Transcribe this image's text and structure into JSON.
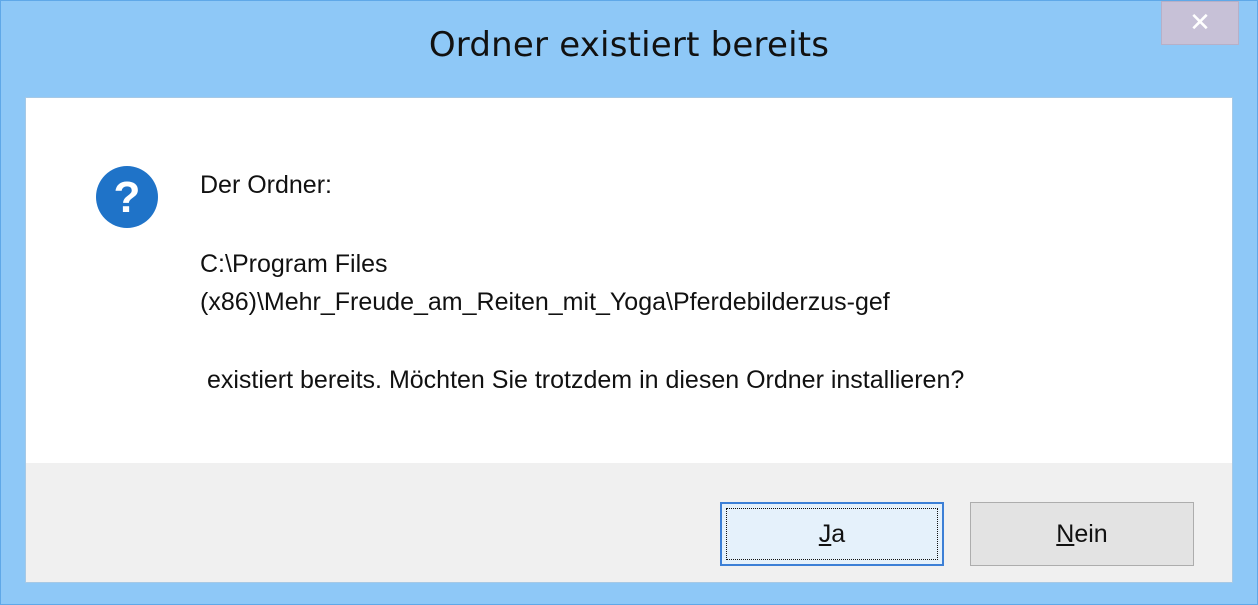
{
  "dialog": {
    "title": "Ordner existiert bereits",
    "close_glyph": "✕",
    "icon": "question-icon",
    "icon_color": "#1f73c8",
    "message": {
      "line1": "Der Ordner:",
      "path_line1": "C:\\Program Files",
      "path_line2": "(x86)\\Mehr_Freude_am_Reiten_mit_Yoga\\Pferdebilderzus-gef",
      "line3": " existiert bereits. Möchten Sie trotzdem in diesen Ordner installieren?"
    },
    "buttons": {
      "yes_mnemonic": "J",
      "yes_rest": "a",
      "no_mnemonic": "N",
      "no_rest": "ein"
    }
  },
  "colors": {
    "titlebar": "#8ec8f7",
    "close_button": "#c7c1d7",
    "default_button_border": "#3c7fd6"
  }
}
